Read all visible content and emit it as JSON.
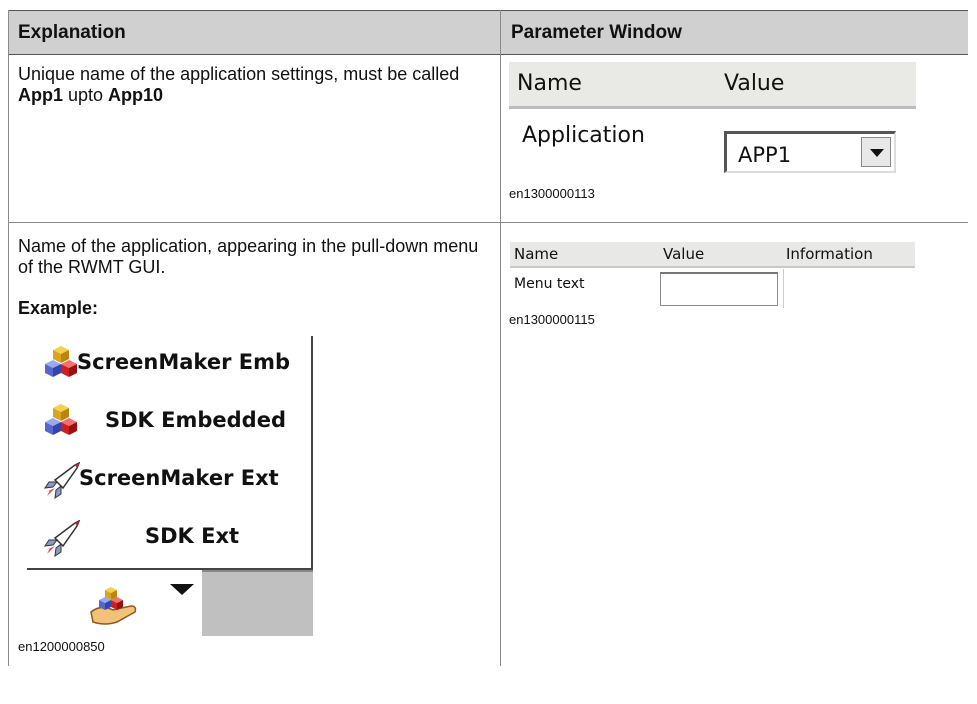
{
  "header": {
    "col1": "Explanation",
    "col2": "Parameter Window"
  },
  "row1": {
    "text_part1": "Unique name of the application settings, must be called ",
    "bold1": "App1",
    "text_part2": " upto ",
    "bold2": "App10",
    "param_window": {
      "col_name": "Name",
      "col_value": "Value",
      "label": "Application",
      "value": "APP1"
    },
    "figure_id": "en1300000113"
  },
  "row2": {
    "text": "Name of the application, appearing in the pull-down menu of the RWMT GUI.",
    "example_label": "Example:",
    "param_window": {
      "col_name": "Name",
      "col_value": "Value",
      "col_info": "Information",
      "label": "Menu text",
      "value": ""
    },
    "param_figure_id": "en1300000115",
    "menu": {
      "items": [
        {
          "label": "ScreenMaker Emb",
          "icon": "cubes-icon"
        },
        {
          "label": "SDK Embedded",
          "icon": "cubes-icon"
        },
        {
          "label": "ScreenMaker Ext",
          "icon": "rocket-icon"
        },
        {
          "label": "SDK Ext",
          "icon": "rocket-icon"
        }
      ],
      "bottom_icon": "hand-cubes-icon"
    },
    "menu_figure_id": "en1200000850"
  }
}
